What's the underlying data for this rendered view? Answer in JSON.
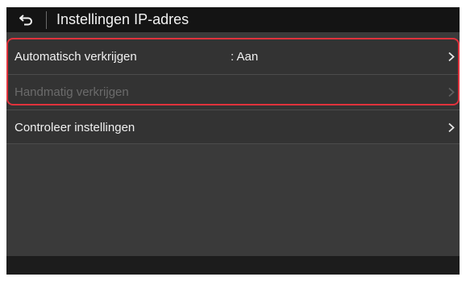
{
  "header": {
    "title": "Instellingen IP-adres",
    "back_icon": "back-arrow-icon"
  },
  "rows": [
    {
      "label": "Automatisch verkrijgen",
      "value": ": Aan",
      "enabled": true
    },
    {
      "label": "Handmatig verkrijgen",
      "value": "",
      "enabled": false
    },
    {
      "label": "Controleer instellingen",
      "value": "",
      "enabled": true
    }
  ],
  "colors": {
    "highlight": "#e0323c",
    "header_bg": "#141414",
    "list_bg": "#333333"
  }
}
